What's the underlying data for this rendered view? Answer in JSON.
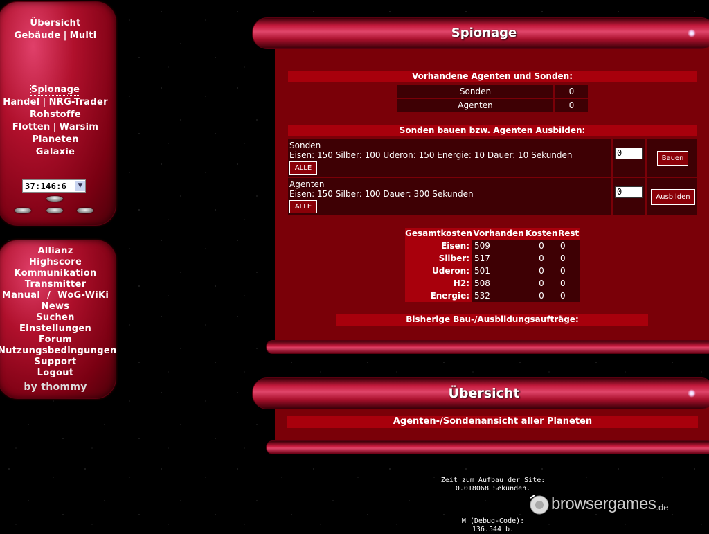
{
  "nav_top": {
    "overview": "Übersicht",
    "buildings": "Gebäude",
    "multi": "Multi",
    "espionage": "Spionage",
    "trade": "Handel",
    "nrg_trader": "NRG-Trader",
    "resources": "Rohstoffe",
    "fleets": "Flotten",
    "warsim": "Warsim",
    "planets": "Planeten",
    "galaxy": "Galaxie",
    "coordinate": "37:146:6"
  },
  "nav_bottom": {
    "items": [
      "Allianz",
      "Highscore",
      "Kommunikation",
      "Transmitter"
    ],
    "manual": "Manual",
    "slash": "/",
    "wiki": "WoG-WiKi",
    "items2": [
      "News",
      "Suchen",
      "Einstellungen",
      "Forum",
      "Nutzungsbedingungen",
      "Support",
      "Logout"
    ],
    "byline": "by thommy"
  },
  "spionage": {
    "title": "Spionage",
    "existing_header": "Vorhandene Agenten und Sonden:",
    "existing": [
      {
        "label": "Sonden",
        "value": "0"
      },
      {
        "label": "Agenten",
        "value": "0"
      }
    ],
    "build_header": "Sonden bauen bzw. Agenten Ausbilden:",
    "build_rows": [
      {
        "name": "Sonden",
        "costs": "Eisen: 150 Silber: 100 Uderon: 150 Energie: 10 Dauer: 10 Sekunden",
        "all_label": "ALLE",
        "input_value": "0",
        "action_label": "Bauen"
      },
      {
        "name": "Agenten",
        "costs": "Eisen: 150 Silber: 100 Dauer: 300 Sekunden",
        "all_label": "ALLE",
        "input_value": "0",
        "action_label": "Ausbilden"
      }
    ],
    "cost_table": {
      "headers": [
        "Gesamtkosten",
        "Vorhanden",
        "Kosten",
        "Rest"
      ],
      "rows": [
        {
          "res": "Eisen:",
          "have": "509",
          "cost": "0",
          "rest": "0"
        },
        {
          "res": "Silber:",
          "have": "517",
          "cost": "0",
          "rest": "0"
        },
        {
          "res": "Uderon:",
          "have": "501",
          "cost": "0",
          "rest": "0"
        },
        {
          "res": "H2:",
          "have": "508",
          "cost": "0",
          "rest": "0"
        },
        {
          "res": "Energie:",
          "have": "532",
          "cost": "0",
          "rest": "0"
        }
      ]
    },
    "orders_header": "Bisherige Bau-/Ausbildungsaufträge:"
  },
  "overview": {
    "title": "Übersicht",
    "header": "Agenten-/Sondenansicht aller Planeten"
  },
  "footer": {
    "build_time_label": "Zeit zum Aufbau der Site:",
    "build_time_value": "0.018068 Sekunden.",
    "debug_label": "M (Debug-Code):",
    "debug_value": "136.544 b.",
    "watermark_main": "browsergames",
    "watermark_tld": ".de"
  },
  "colors": {
    "accent": "#a8000c",
    "panel": "#7a0008",
    "cell": "#3e0004"
  }
}
